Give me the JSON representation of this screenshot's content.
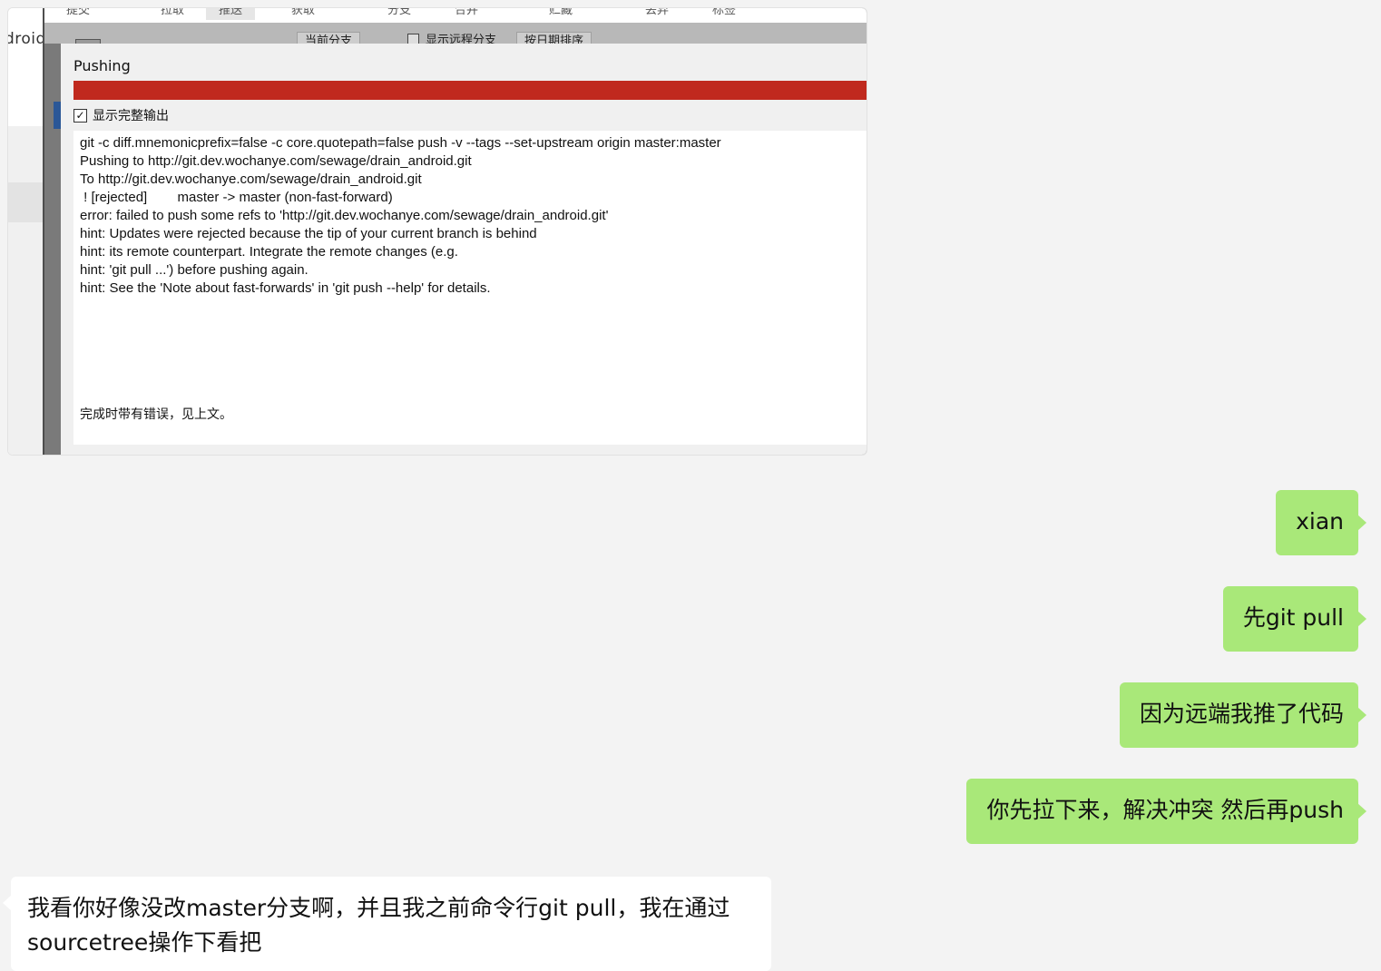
{
  "screenshot": {
    "app_label": "droid",
    "toolbar_items": [
      "提交",
      "拉取",
      "推送",
      "获取",
      "分支",
      "合并",
      "贮藏",
      "丢弃",
      "标签"
    ],
    "active_toolbar_item": "推送",
    "filter_bar": {
      "branch_select": "当前分支",
      "show_remote_branches_label": "显示远程分支",
      "show_remote_branches_checked": true,
      "sort_select": "按日期排序"
    },
    "dialog": {
      "title": "Pushing",
      "progress_percent": 100,
      "progress_color": "#c0291e",
      "show_full_output_label": "显示完整输出",
      "show_full_output_checked": true,
      "output_lines": [
        "git -c diff.mnemonicprefix=false -c core.quotepath=false push -v --tags --set-upstream origin master:master",
        "Pushing to http://git.dev.wochanye.com/sewage/drain_android.git",
        "To http://git.dev.wochanye.com/sewage/drain_android.git",
        " ! [rejected]        master -> master (non-fast-forward)",
        "error: failed to push some refs to 'http://git.dev.wochanye.com/sewage/drain_android.git'",
        "hint: Updates were rejected because the tip of your current branch is behind",
        "hint: its remote counterpart. Integrate the remote changes (e.g.",
        "hint: 'git pull ...') before pushing again.",
        "hint: See the 'Note about fast-forwards' in 'git push --help' for details."
      ],
      "status_text": "完成时带有错误，见上文。"
    }
  },
  "messages": [
    {
      "direction": "outgoing",
      "text": "xian"
    },
    {
      "direction": "outgoing",
      "text": "先git pull"
    },
    {
      "direction": "outgoing",
      "text": "因为远端我推了代码"
    },
    {
      "direction": "outgoing",
      "text": "你先拉下来，解决冲突 然后再push"
    },
    {
      "direction": "incoming",
      "text": "我看你好像没改master分支啊，并且我之前命令行git pull，我在通过sourcetree操作下看把"
    }
  ],
  "colors": {
    "outgoing_bubble": "#a9e879",
    "incoming_bubble": "#ffffff",
    "background": "#f3f3f3"
  }
}
